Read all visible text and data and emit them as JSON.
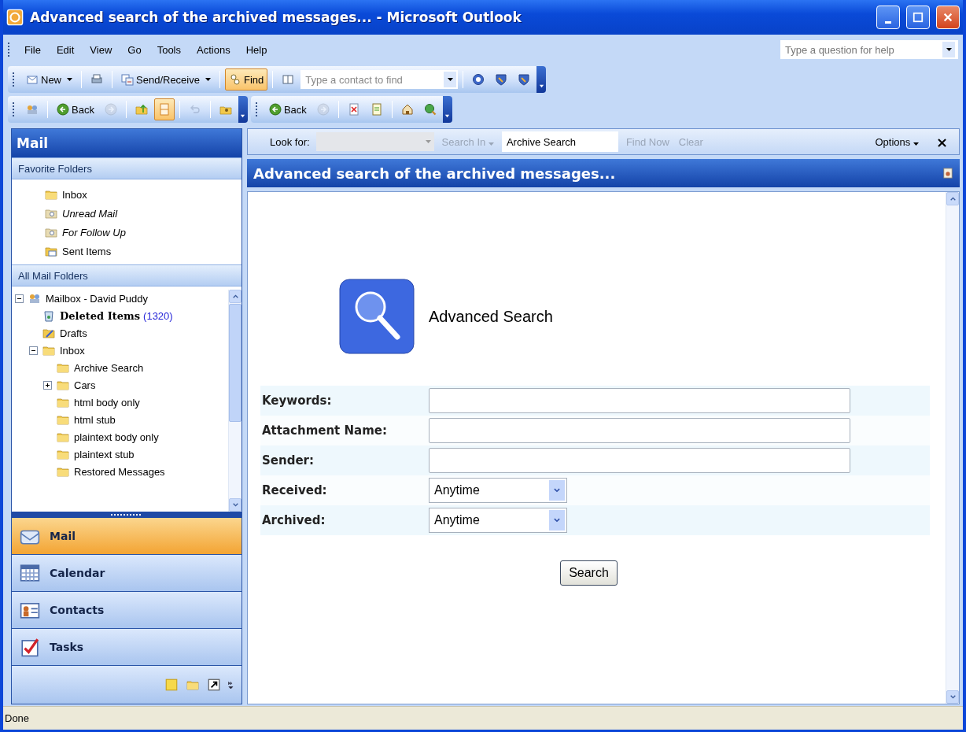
{
  "window": {
    "title": "Advanced search of the archived messages... - Microsoft Outlook"
  },
  "menu": [
    {
      "label": "File"
    },
    {
      "label": "Edit"
    },
    {
      "label": "View"
    },
    {
      "label": "Go"
    },
    {
      "label": "Tools"
    },
    {
      "label": "Actions"
    },
    {
      "label": "Help"
    }
  ],
  "help_box": {
    "placeholder": "Type a question for help"
  },
  "toolbars": [
    {
      "groups": [
        [
          {
            "kind": "button",
            "label": "New",
            "dropdown": true,
            "selected": false,
            "disabled": false
          }
        ],
        [
          {
            "kind": "button",
            "selected": false,
            "disabled": false
          }
        ],
        [
          {
            "kind": "button",
            "label": "Send/Receive",
            "dropdown": true,
            "selected": false,
            "disabled": false
          }
        ],
        [
          {
            "kind": "button",
            "label": "Find",
            "selected": true,
            "disabled": false
          }
        ],
        [
          {
            "kind": "button",
            "selected": false,
            "disabled": false
          },
          {
            "kind": "field",
            "placeholder": "Type a contact to find"
          }
        ],
        [
          {
            "kind": "button",
            "selected": false,
            "disabled": false
          },
          {
            "kind": "button",
            "selected": false,
            "disabled": false
          },
          {
            "kind": "button",
            "selected": false,
            "disabled": false
          }
        ]
      ]
    },
    {
      "groups": [
        [
          {
            "kind": "button",
            "selected": false,
            "disabled": false
          }
        ],
        [
          {
            "kind": "button",
            "label": "Back",
            "selected": false,
            "disabled": false
          },
          {
            "kind": "button",
            "selected": false,
            "disabled": true
          }
        ],
        [
          {
            "kind": "button",
            "selected": false,
            "disabled": false
          },
          {
            "kind": "button",
            "selected": true,
            "disabled": false
          }
        ],
        [
          {
            "kind": "button",
            "selected": false,
            "disabled": true
          }
        ],
        [
          {
            "kind": "button",
            "selected": false,
            "disabled": false
          }
        ]
      ]
    },
    {
      "groups": [
        [
          {
            "kind": "button",
            "label": "Back",
            "selected": false,
            "disabled": false
          },
          {
            "kind": "button",
            "selected": false,
            "disabled": true
          }
        ],
        [
          {
            "kind": "button",
            "selected": false,
            "disabled": false
          },
          {
            "kind": "button",
            "selected": false,
            "disabled": false
          }
        ],
        [
          {
            "kind": "button",
            "selected": false,
            "disabled": false
          },
          {
            "kind": "button",
            "selected": false,
            "disabled": false
          }
        ]
      ]
    }
  ],
  "navigation_pane": {
    "title": "Mail",
    "favorites": {
      "title": "Favorite Folders",
      "items": [
        {
          "label": "Inbox",
          "kind": "inbox"
        },
        {
          "label": "Unread Mail",
          "kind": "search"
        },
        {
          "label": "For Follow Up",
          "kind": "search"
        },
        {
          "label": "Sent Items",
          "kind": "sent"
        }
      ]
    },
    "all_folders": {
      "title": "All Mail Folders",
      "tree": [
        {
          "label": "Mailbox - David Puddy",
          "kind": "mailbox",
          "expanded": true,
          "children": [
            {
              "label": "Deleted Items",
              "kind": "deleted",
              "unread_count": "(1320)"
            },
            {
              "label": "Drafts",
              "kind": "drafts"
            },
            {
              "label": "Inbox",
              "kind": "inbox",
              "expanded": true,
              "children": [
                {
                  "label": "Archive Search",
                  "kind": "folder"
                },
                {
                  "label": "Cars",
                  "kind": "folder",
                  "expanded": false
                },
                {
                  "label": "html body only",
                  "kind": "folder"
                },
                {
                  "label": "html stub",
                  "kind": "folder"
                },
                {
                  "label": "plaintext body only",
                  "kind": "folder"
                },
                {
                  "label": "plaintext stub",
                  "kind": "folder"
                },
                {
                  "label": "Restored Messages",
                  "kind": "folder"
                }
              ]
            }
          ]
        }
      ]
    },
    "buttons": [
      {
        "label": "Mail",
        "selected": true
      },
      {
        "label": "Calendar",
        "selected": false
      },
      {
        "label": "Contacts",
        "selected": false
      },
      {
        "label": "Tasks",
        "selected": false
      }
    ]
  },
  "find_bar": {
    "look_for_label": "Look for:",
    "look_for_disabled": true,
    "search_in": "Search In",
    "scope": "Archive Search",
    "find_now": "Find Now",
    "clear": "Clear",
    "actions_disabled": true,
    "options": "Options",
    "close": "×"
  },
  "content": {
    "header": "Advanced search of the archived messages...",
    "heading": "Advanced Search",
    "fields": [
      {
        "label": "Keywords:",
        "kind": "text"
      },
      {
        "label": "Attachment Name:",
        "kind": "text"
      },
      {
        "label": "Sender:",
        "kind": "text"
      },
      {
        "label": "Received:",
        "kind": "select",
        "value": "Anytime"
      },
      {
        "label": "Archived:",
        "kind": "select",
        "value": "Anytime"
      }
    ],
    "submit": "Search"
  },
  "status_bar": {
    "text": "Done"
  }
}
